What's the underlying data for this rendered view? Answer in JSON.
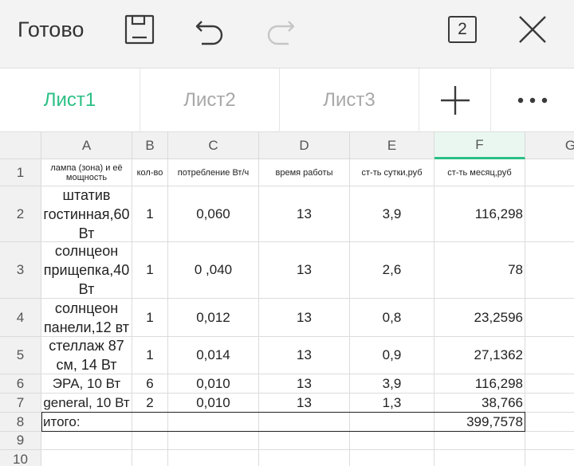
{
  "toolbar": {
    "done_label": "Готово",
    "icons": [
      "save-icon",
      "undo-icon",
      "redo-icon",
      "sheet-count-icon",
      "close-icon"
    ],
    "sheet_count": "2"
  },
  "tabs": {
    "items": [
      {
        "label": "Лист1"
      },
      {
        "label": "Лист2"
      },
      {
        "label": "Лист3"
      }
    ],
    "active_color": "#2bbf85"
  },
  "grid": {
    "columns": [
      "A",
      "B",
      "C",
      "D",
      "E",
      "F",
      "G"
    ],
    "rows": [
      "1",
      "2",
      "3",
      "4",
      "5",
      "6",
      "7",
      "8",
      "9",
      "10"
    ],
    "header_row": {
      "a": "лампа (зона) и её мощность",
      "b": "кол-во",
      "c": "потребление Вт/ч",
      "d": "время работы",
      "e": "ст-ть сутки,руб",
      "f": "ст-ть месяц,руб"
    },
    "data": [
      {
        "a": "штатив гостинная,60 Вт",
        "b": "1",
        "c": "0,060",
        "d": "13",
        "e": "3,9",
        "f": "116,298"
      },
      {
        "a": "солнцеон прищепка,40 Вт",
        "b": "1",
        "c": "0 ,040",
        "d": "13",
        "e": "2,6",
        "f": "78"
      },
      {
        "a": "солнцеон панели,12 вт",
        "b": "1",
        "c": "0,012",
        "d": "13",
        "e": "0,8",
        "f": "23,2596"
      },
      {
        "a": "стеллаж 87 см, 14 Вт",
        "b": "1",
        "c": "0,014",
        "d": "13",
        "e": "0,9",
        "f": "27,1362"
      },
      {
        "a": "ЭРА, 10 Вт",
        "b": "6",
        "c": "0,010",
        "d": "13",
        "e": "3,9",
        "f": "116,298"
      },
      {
        "a": "general, 10 Вт",
        "b": "2",
        "c": "0,010",
        "d": "13",
        "e": "1,3",
        "f": "38,766"
      }
    ],
    "total": {
      "label": "итого:",
      "value": "399,7578"
    }
  }
}
